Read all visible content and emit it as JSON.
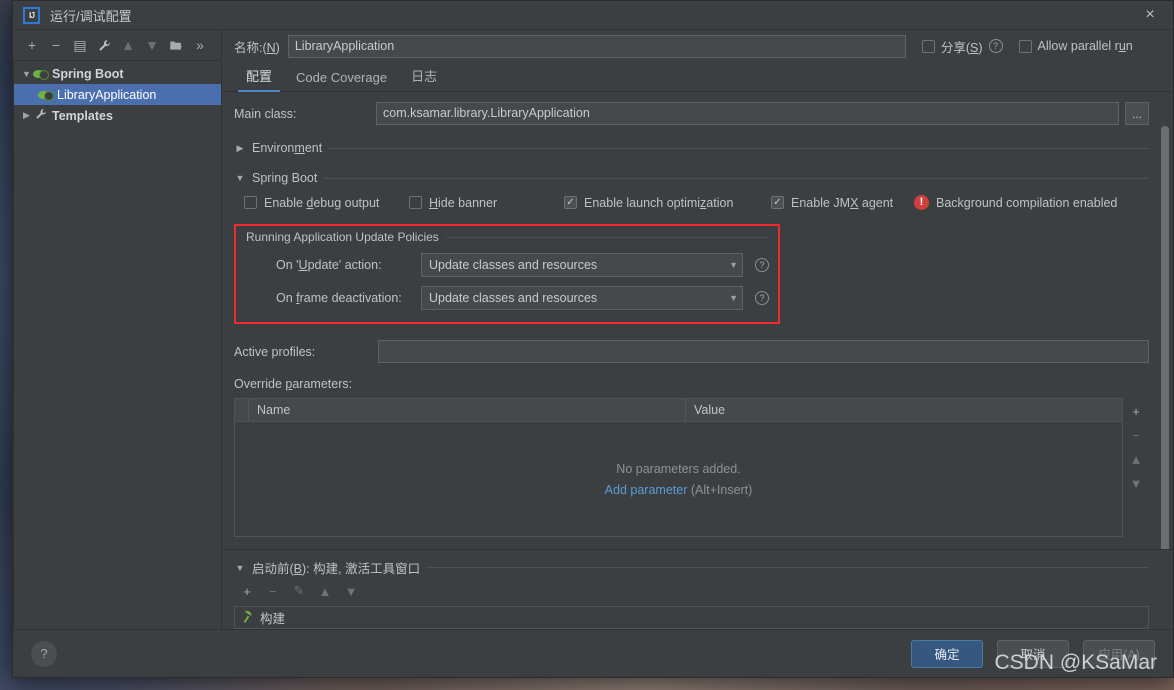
{
  "window": {
    "title": "运行/调试配置",
    "logo_text": "IJ",
    "close_icon": "×"
  },
  "sidebar": {
    "toolbar": [
      {
        "name": "add-configuration",
        "glyph": "+",
        "dim": false
      },
      {
        "name": "remove-configuration",
        "glyph": "−",
        "dim": false
      },
      {
        "name": "copy-configuration",
        "glyph": "▤",
        "dim": false
      },
      {
        "name": "edit-templates",
        "glyph": "🔧",
        "dim": false
      },
      {
        "name": "move-up",
        "glyph": "▲",
        "dim": true
      },
      {
        "name": "move-down",
        "glyph": "▼",
        "dim": true
      },
      {
        "name": "move-into-folder",
        "glyph": "🗀",
        "dim": false
      },
      {
        "name": "more-options",
        "glyph": "»",
        "dim": false
      }
    ],
    "tree": [
      {
        "label": "Spring Boot",
        "arrow": "▼",
        "icon": "spring-boot-icon",
        "indent": false,
        "selected": false,
        "bold": true
      },
      {
        "label": "LibraryApplication",
        "arrow": "",
        "icon": "spring-boot-icon",
        "indent": true,
        "selected": true,
        "bold": false
      },
      {
        "label": "Templates",
        "arrow": "▶",
        "icon": "wrench-icon",
        "indent": false,
        "selected": false,
        "bold": true
      }
    ]
  },
  "header": {
    "name_label_prefix": "名称:(",
    "name_label_mnemonic": "N",
    "name_label_suffix": ")",
    "name_value": "LibraryApplication",
    "share_label_prefix": "分享(",
    "share_label_mnemonic": "S",
    "share_label_suffix": ")",
    "share_checked": false,
    "share_help_icon": "?",
    "allow_parallel_prefix": "Allow parallel r",
    "allow_parallel_mnemonic": "u",
    "allow_parallel_suffix": "n",
    "allow_parallel_checked": false
  },
  "tabs": [
    {
      "label": "配置",
      "active": true
    },
    {
      "label": "Code Coverage",
      "active": false
    },
    {
      "label": "日志",
      "active": false
    }
  ],
  "main": {
    "main_class_label": "Main class:",
    "main_class_value": "com.ksamar.library.LibraryApplication",
    "browse_button": "...",
    "environment_section": {
      "arrow": "▶",
      "title_prefix": "Environ",
      "title_mnemonic": "m",
      "title_suffix": "ent"
    },
    "spring_boot_section": {
      "arrow": "▼",
      "title_prefix": "Sprin",
      "title_mnemonic": "g",
      "title_suffix": " Boot"
    },
    "checkboxes": [
      {
        "name": "enable-debug-output",
        "prefix": "Enable ",
        "mnemonic": "d",
        "suffix": "ebug output",
        "checked": false
      },
      {
        "name": "hide-banner",
        "prefix": "",
        "mnemonic": "H",
        "suffix": "ide banner",
        "checked": false
      },
      {
        "name": "enable-launch-optimization",
        "prefix": "Enable launch optimi",
        "mnemonic": "z",
        "suffix": "ation",
        "checked": true
      },
      {
        "name": "enable-jmx-agent",
        "prefix": "Enable JM",
        "mnemonic": "X",
        "suffix": " agent",
        "checked": true
      }
    ],
    "warning": {
      "icon": "!",
      "text": "Background compilation enabled"
    },
    "policies": {
      "legend": "Running Application Update Policies",
      "border_color": "#f02a2a",
      "rows": [
        {
          "name": "on-update-action",
          "label_prefix": "On '",
          "label_mnemonic": "U",
          "label_suffix": "pdate' action:",
          "value": "Update classes and resources",
          "caret": "▼",
          "help_icon": "?"
        },
        {
          "name": "on-frame-deactivation",
          "label_prefix": "On ",
          "label_mnemonic": "f",
          "label_suffix": "rame deactivation:",
          "value": "Update classes and resources",
          "caret": "▼",
          "help_icon": "?"
        }
      ]
    },
    "active_profiles_label": "Active profiles:",
    "active_profiles_value": "",
    "override_parameters_prefix": "Override ",
    "override_parameters_mnemonic": "p",
    "override_parameters_suffix": "arameters:",
    "parameters_table": {
      "columns": [
        "Name",
        "Value"
      ],
      "rows": [],
      "empty_text": "No parameters added.",
      "empty_action_link": "Add parameter",
      "empty_action_hint": "(Alt+Insert)",
      "side_buttons": [
        {
          "name": "add-parameter-button",
          "glyph": "+",
          "dim": false
        },
        {
          "name": "remove-parameter-button",
          "glyph": "−",
          "dim": true
        },
        {
          "name": "move-parameter-up-button",
          "glyph": "▲",
          "dim": true
        },
        {
          "name": "move-parameter-down-button",
          "glyph": "▼",
          "dim": true
        }
      ]
    }
  },
  "before_launch": {
    "arrow": "▼",
    "title_prefix": "启动前(",
    "title_mnemonic": "B",
    "title_suffix": "): 构建, 激活工具窗口",
    "toolbar": [
      {
        "name": "add-task-button",
        "glyph": "+",
        "dim": false
      },
      {
        "name": "remove-task-button",
        "glyph": "−",
        "dim": true
      },
      {
        "name": "edit-task-button",
        "glyph": "✎",
        "dim": true
      },
      {
        "name": "task-move-up-button",
        "glyph": "▲",
        "dim": true
      },
      {
        "name": "task-move-down-button",
        "glyph": "▼",
        "dim": true
      }
    ],
    "items": [
      {
        "icon": "hammer-icon",
        "label": "构建"
      }
    ]
  },
  "footer": {
    "help_icon": "?",
    "buttons": [
      {
        "name": "ok-button",
        "label": "确定",
        "primary": true,
        "disabled": false
      },
      {
        "name": "cancel-button",
        "label": "取消",
        "primary": false,
        "disabled": false
      },
      {
        "name": "apply-button",
        "label": "应用(A)",
        "primary": false,
        "disabled": true
      }
    ],
    "watermark": "CSDN @KSaMar"
  }
}
